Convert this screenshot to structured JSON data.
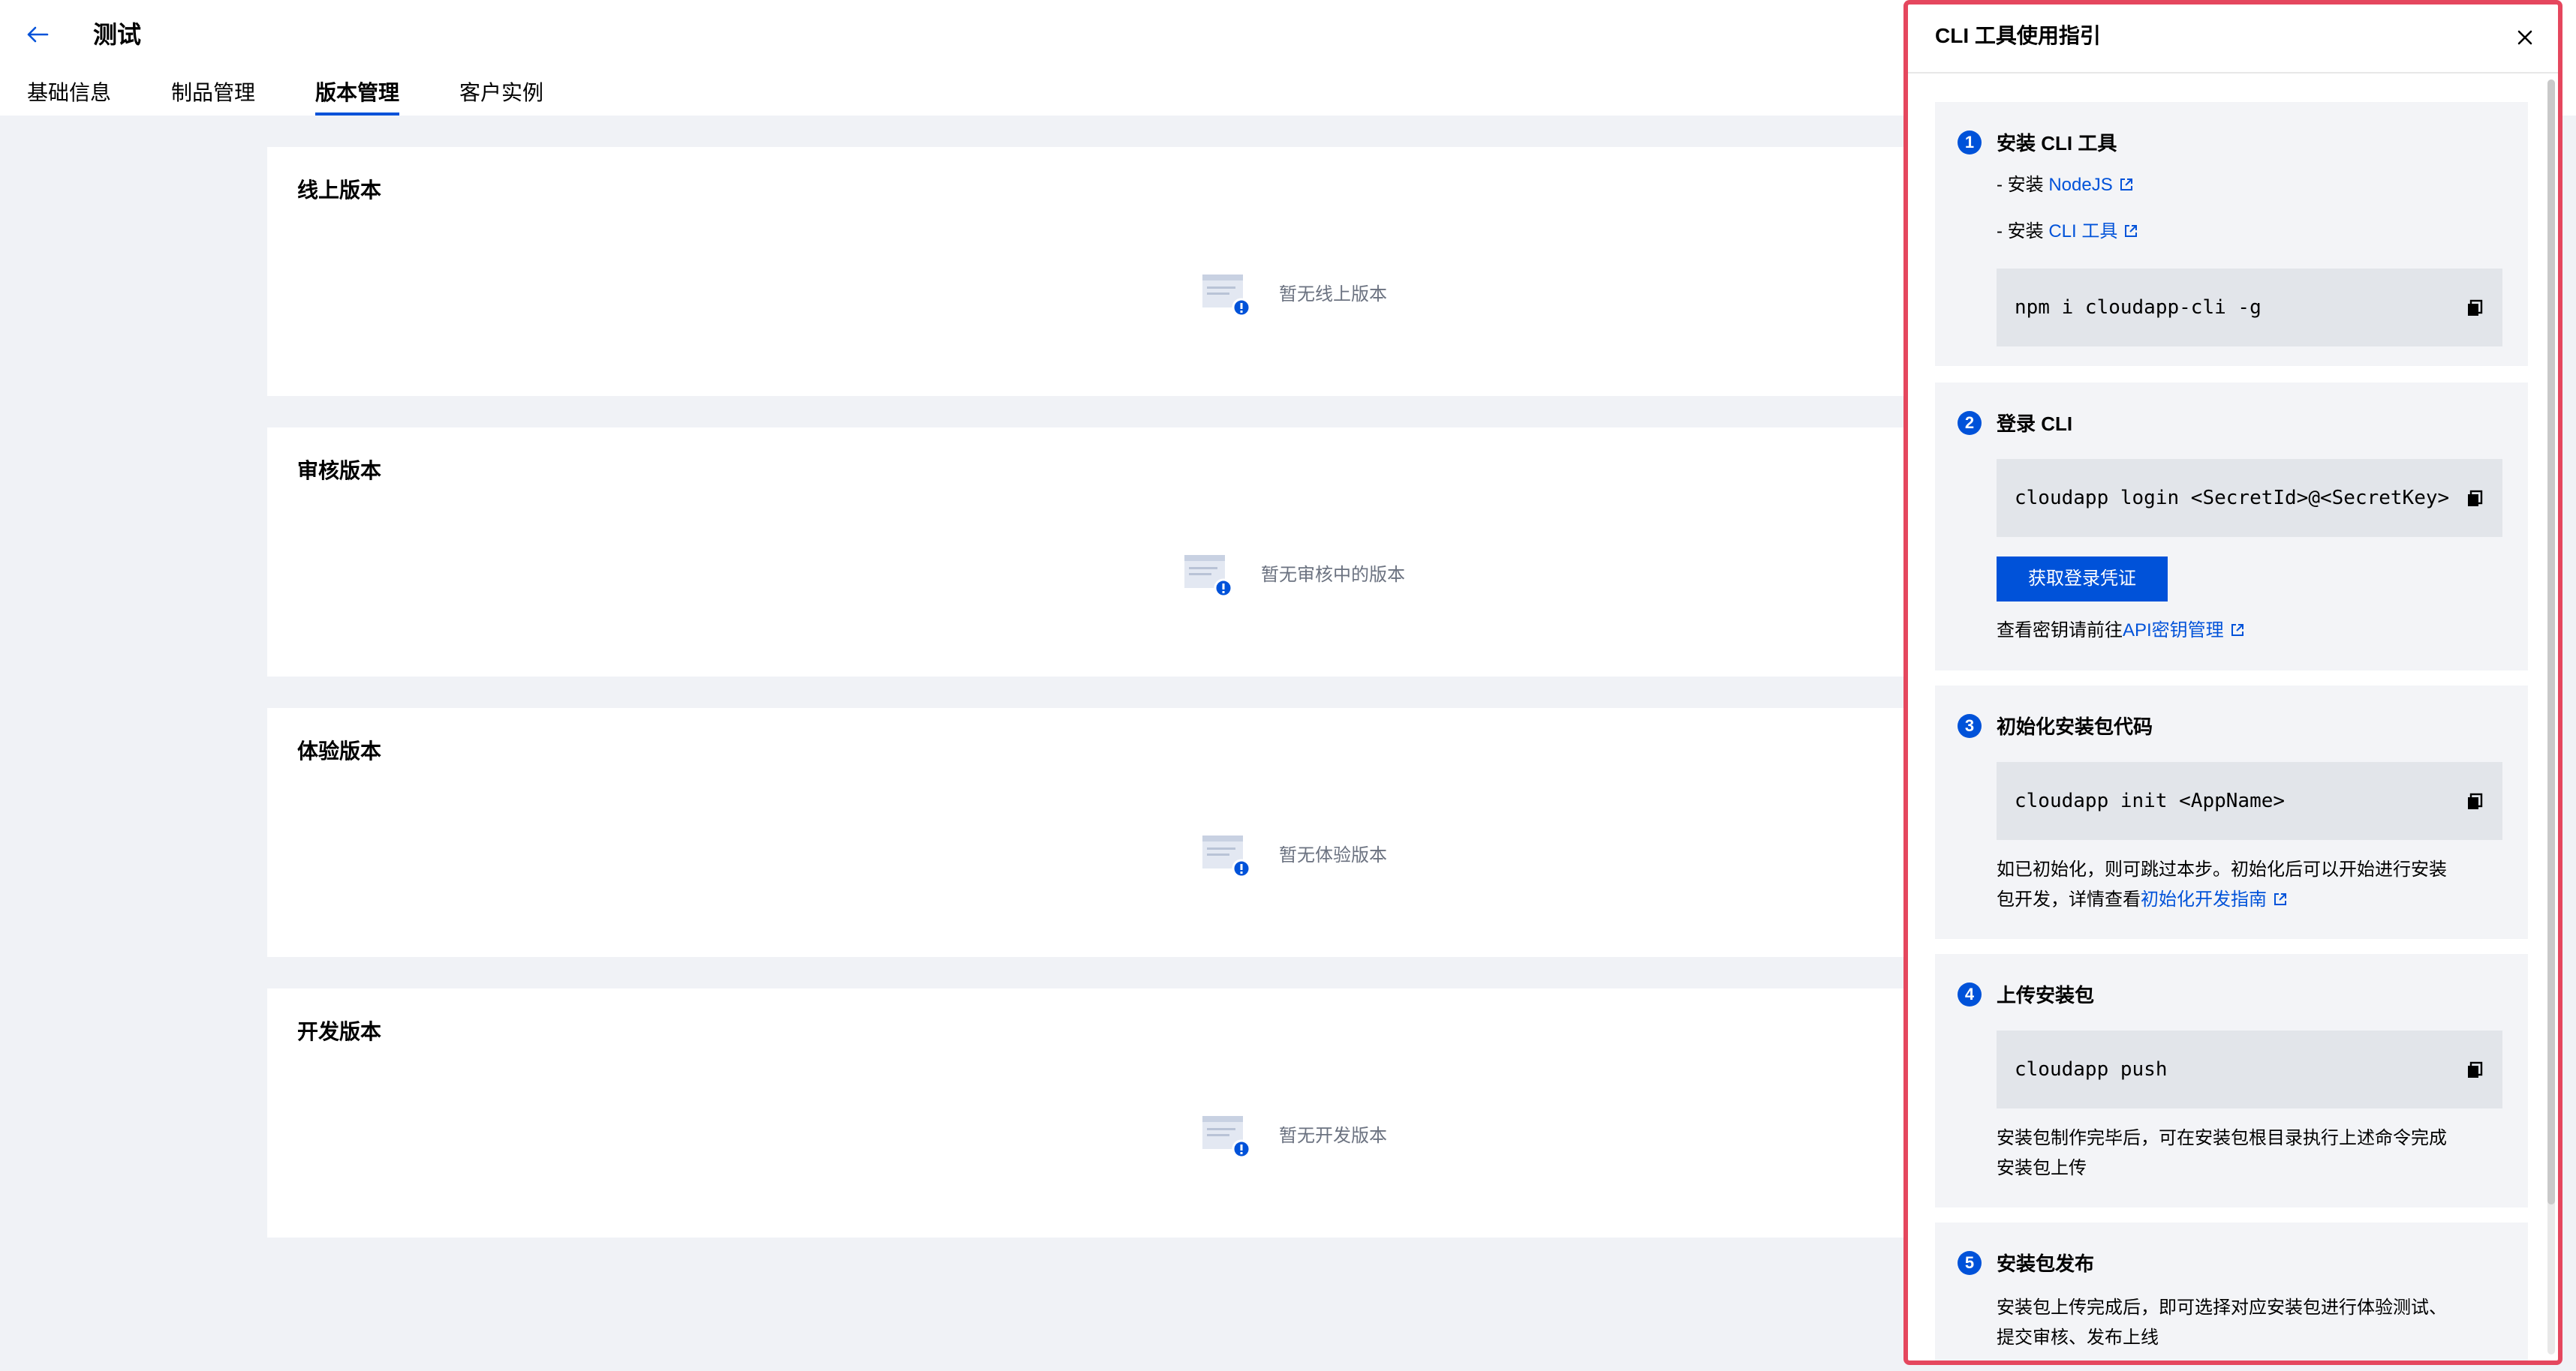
{
  "header": {
    "title": "测试",
    "tabs": [
      {
        "label": "基础信息",
        "active": false
      },
      {
        "label": "制品管理",
        "active": false
      },
      {
        "label": "版本管理",
        "active": true
      },
      {
        "label": "客户实例",
        "active": false
      }
    ]
  },
  "cards": [
    {
      "title": "线上版本",
      "empty_text": "暂无线上版本"
    },
    {
      "title": "审核版本",
      "empty_text": "暂无审核中的版本"
    },
    {
      "title": "体验版本",
      "empty_text": "暂无体验版本"
    },
    {
      "title": "开发版本",
      "empty_text": "暂无开发版本"
    }
  ],
  "panel": {
    "title": "CLI 工具使用指引",
    "steps": [
      {
        "num": "1",
        "title": "安装 CLI 工具",
        "lines": [
          {
            "prefix": "- 安装 ",
            "link": "NodeJS"
          },
          {
            "prefix": "- 安装 ",
            "link": "CLI 工具"
          }
        ],
        "code": "npm i cloudapp-cli -g"
      },
      {
        "num": "2",
        "title": "登录 CLI",
        "code": "cloudapp login <SecretId>@<SecretKey>",
        "button": "获取登录凭证",
        "note_prefix": "查看密钥请前往",
        "note_link": "API密钥管理"
      },
      {
        "num": "3",
        "title": "初始化安装包代码",
        "code": "cloudapp init <AppName>",
        "para_line1": "如已初始化，则可跳过本步。初始化后可以开始进行安装",
        "para_line2_prefix": "包开发，详情查看",
        "para_link": "初始化开发指南"
      },
      {
        "num": "4",
        "title": "上传安装包",
        "code": "cloudapp push",
        "para_line1": "安装包制作完毕后，可在安装包根目录执行上述命令完成",
        "para_line2": "安装包上传"
      },
      {
        "num": "5",
        "title": "安装包发布",
        "para_line1": "安装包上传完成后，即可选择对应安装包进行体验测试、",
        "para_line2": "提交审核、发布上线"
      }
    ]
  },
  "colors": {
    "accent": "#0052d9",
    "panel_highlight_border": "#e5475e",
    "page_background": "#f0f2f6"
  }
}
